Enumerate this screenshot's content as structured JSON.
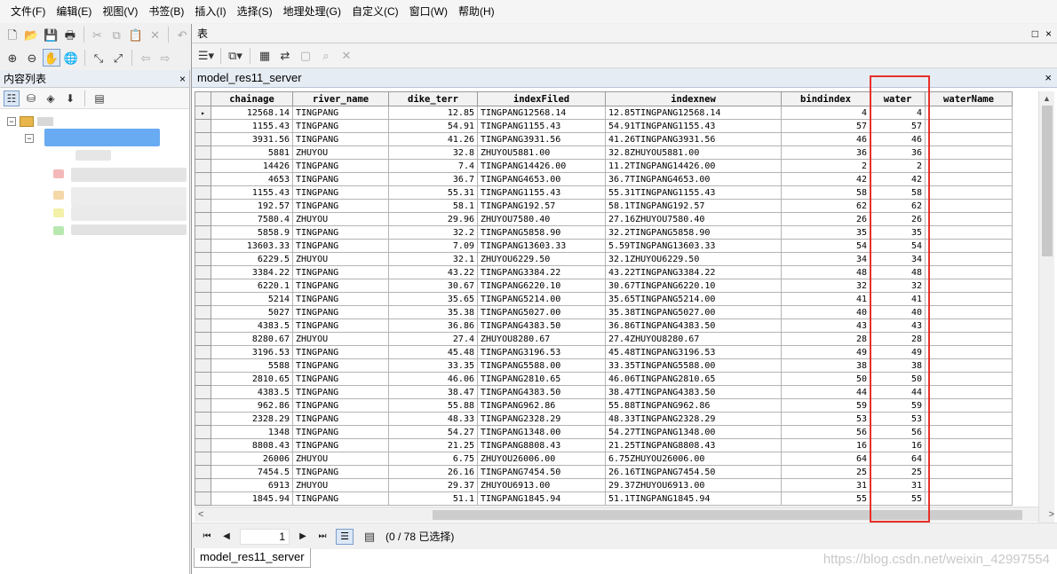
{
  "menu": [
    "文件(F)",
    "编辑(E)",
    "视图(V)",
    "书签(B)",
    "插入(I)",
    "选择(S)",
    "地理处理(G)",
    "自定义(C)",
    "窗口(W)",
    "帮助(H)"
  ],
  "toolbar1_icons": [
    "new-icon",
    "open-icon",
    "save-icon",
    "print-icon",
    "cut-icon",
    "copy-icon",
    "paste-icon",
    "delete-icon",
    "undo-icon"
  ],
  "toolbar2_icons": [
    "zoom-in-icon",
    "zoom-out-icon",
    "pan-icon",
    "globe-icon",
    "fixed-zoom-in-icon",
    "fixed-zoom-out-icon",
    "back-icon",
    "forward-icon"
  ],
  "toc": {
    "title": "内容列表",
    "close": "×"
  },
  "table_window": {
    "title": "表",
    "max": "□",
    "close": "×",
    "tab_label": "model_res11_server",
    "tab_close": "×",
    "bottom_tab": "model_res11_server"
  },
  "navigation": {
    "current_record": "1",
    "selection_status": "(0 / 78 已选择)"
  },
  "grid": {
    "columns": [
      "chainage",
      "river_name",
      "dike_terr",
      "indexFiled",
      "indexnew",
      "bindindex",
      "water",
      "waterName"
    ],
    "rows": [
      [
        "12568.14",
        "TINGPANG",
        "12.85",
        "TINGPANG12568.14",
        "12.85TINGPANG12568.14",
        "4",
        "4",
        ""
      ],
      [
        "1155.43",
        "TINGPANG",
        "54.91",
        "TINGPANG1155.43",
        "54.91TINGPANG1155.43",
        "57",
        "57",
        ""
      ],
      [
        "3931.56",
        "TINGPANG",
        "41.26",
        "TINGPANG3931.56",
        "41.26TINGPANG3931.56",
        "46",
        "46",
        ""
      ],
      [
        "5881",
        "ZHUYOU",
        "32.8",
        "ZHUYOU5881.00",
        "32.8ZHUYOU5881.00",
        "36",
        "36",
        ""
      ],
      [
        "14426",
        "TINGPANG",
        "7.4",
        "TINGPANG14426.00",
        "11.2TINGPANG14426.00",
        "2",
        "2",
        ""
      ],
      [
        "4653",
        "TINGPANG",
        "36.7",
        "TINGPANG4653.00",
        "36.7TINGPANG4653.00",
        "42",
        "42",
        ""
      ],
      [
        "1155.43",
        "TINGPANG",
        "55.31",
        "TINGPANG1155.43",
        "55.31TINGPANG1155.43",
        "58",
        "58",
        ""
      ],
      [
        "192.57",
        "TINGPANG",
        "58.1",
        "TINGPANG192.57",
        "58.1TINGPANG192.57",
        "62",
        "62",
        ""
      ],
      [
        "7580.4",
        "ZHUYOU",
        "29.96",
        "ZHUYOU7580.40",
        "27.16ZHUYOU7580.40",
        "26",
        "26",
        ""
      ],
      [
        "5858.9",
        "TINGPANG",
        "32.2",
        "TINGPANG5858.90",
        "32.2TINGPANG5858.90",
        "35",
        "35",
        ""
      ],
      [
        "13603.33",
        "TINGPANG",
        "7.09",
        "TINGPANG13603.33",
        "5.59TINGPANG13603.33",
        "54",
        "54",
        ""
      ],
      [
        "6229.5",
        "ZHUYOU",
        "32.1",
        "ZHUYOU6229.50",
        "32.1ZHUYOU6229.50",
        "34",
        "34",
        ""
      ],
      [
        "3384.22",
        "TINGPANG",
        "43.22",
        "TINGPANG3384.22",
        "43.22TINGPANG3384.22",
        "48",
        "48",
        ""
      ],
      [
        "6220.1",
        "TINGPANG",
        "30.67",
        "TINGPANG6220.10",
        "30.67TINGPANG6220.10",
        "32",
        "32",
        ""
      ],
      [
        "5214",
        "TINGPANG",
        "35.65",
        "TINGPANG5214.00",
        "35.65TINGPANG5214.00",
        "41",
        "41",
        ""
      ],
      [
        "5027",
        "TINGPANG",
        "35.38",
        "TINGPANG5027.00",
        "35.38TINGPANG5027.00",
        "40",
        "40",
        ""
      ],
      [
        "4383.5",
        "TINGPANG",
        "36.86",
        "TINGPANG4383.50",
        "36.86TINGPANG4383.50",
        "43",
        "43",
        ""
      ],
      [
        "8280.67",
        "ZHUYOU",
        "27.4",
        "ZHUYOU8280.67",
        "27.4ZHUYOU8280.67",
        "28",
        "28",
        ""
      ],
      [
        "3196.53",
        "TINGPANG",
        "45.48",
        "TINGPANG3196.53",
        "45.48TINGPANG3196.53",
        "49",
        "49",
        ""
      ],
      [
        "5588",
        "TINGPANG",
        "33.35",
        "TINGPANG5588.00",
        "33.35TINGPANG5588.00",
        "38",
        "38",
        ""
      ],
      [
        "2810.65",
        "TINGPANG",
        "46.06",
        "TINGPANG2810.65",
        "46.06TINGPANG2810.65",
        "50",
        "50",
        ""
      ],
      [
        "4383.5",
        "TINGPANG",
        "38.47",
        "TINGPANG4383.50",
        "38.47TINGPANG4383.50",
        "44",
        "44",
        ""
      ],
      [
        "962.86",
        "TINGPANG",
        "55.88",
        "TINGPANG962.86",
        "55.88TINGPANG962.86",
        "59",
        "59",
        ""
      ],
      [
        "2328.29",
        "TINGPANG",
        "48.33",
        "TINGPANG2328.29",
        "48.33TINGPANG2328.29",
        "53",
        "53",
        ""
      ],
      [
        "1348",
        "TINGPANG",
        "54.27",
        "TINGPANG1348.00",
        "54.27TINGPANG1348.00",
        "56",
        "56",
        ""
      ],
      [
        "8808.43",
        "TINGPANG",
        "21.25",
        "TINGPANG8808.43",
        "21.25TINGPANG8808.43",
        "16",
        "16",
        ""
      ],
      [
        "26006",
        "ZHUYOU",
        "6.75",
        "ZHUYOU26006.00",
        "6.75ZHUYOU26006.00",
        "64",
        "64",
        ""
      ],
      [
        "7454.5",
        "TINGPANG",
        "26.16",
        "TINGPANG7454.50",
        "26.16TINGPANG7454.50",
        "25",
        "25",
        ""
      ],
      [
        "6913",
        "ZHUYOU",
        "29.37",
        "ZHUYOU6913.00",
        "29.37ZHUYOU6913.00",
        "31",
        "31",
        ""
      ],
      [
        "1845.94",
        "TINGPANG",
        "51.1",
        "TINGPANG1845.94",
        "51.1TINGPANG1845.94",
        "55",
        "55",
        ""
      ]
    ]
  },
  "watermark": "https://blog.csdn.net/weixin_42997554",
  "colors": {
    "highlight": "#e8302a",
    "tab_bg": "#e6ecf4"
  }
}
